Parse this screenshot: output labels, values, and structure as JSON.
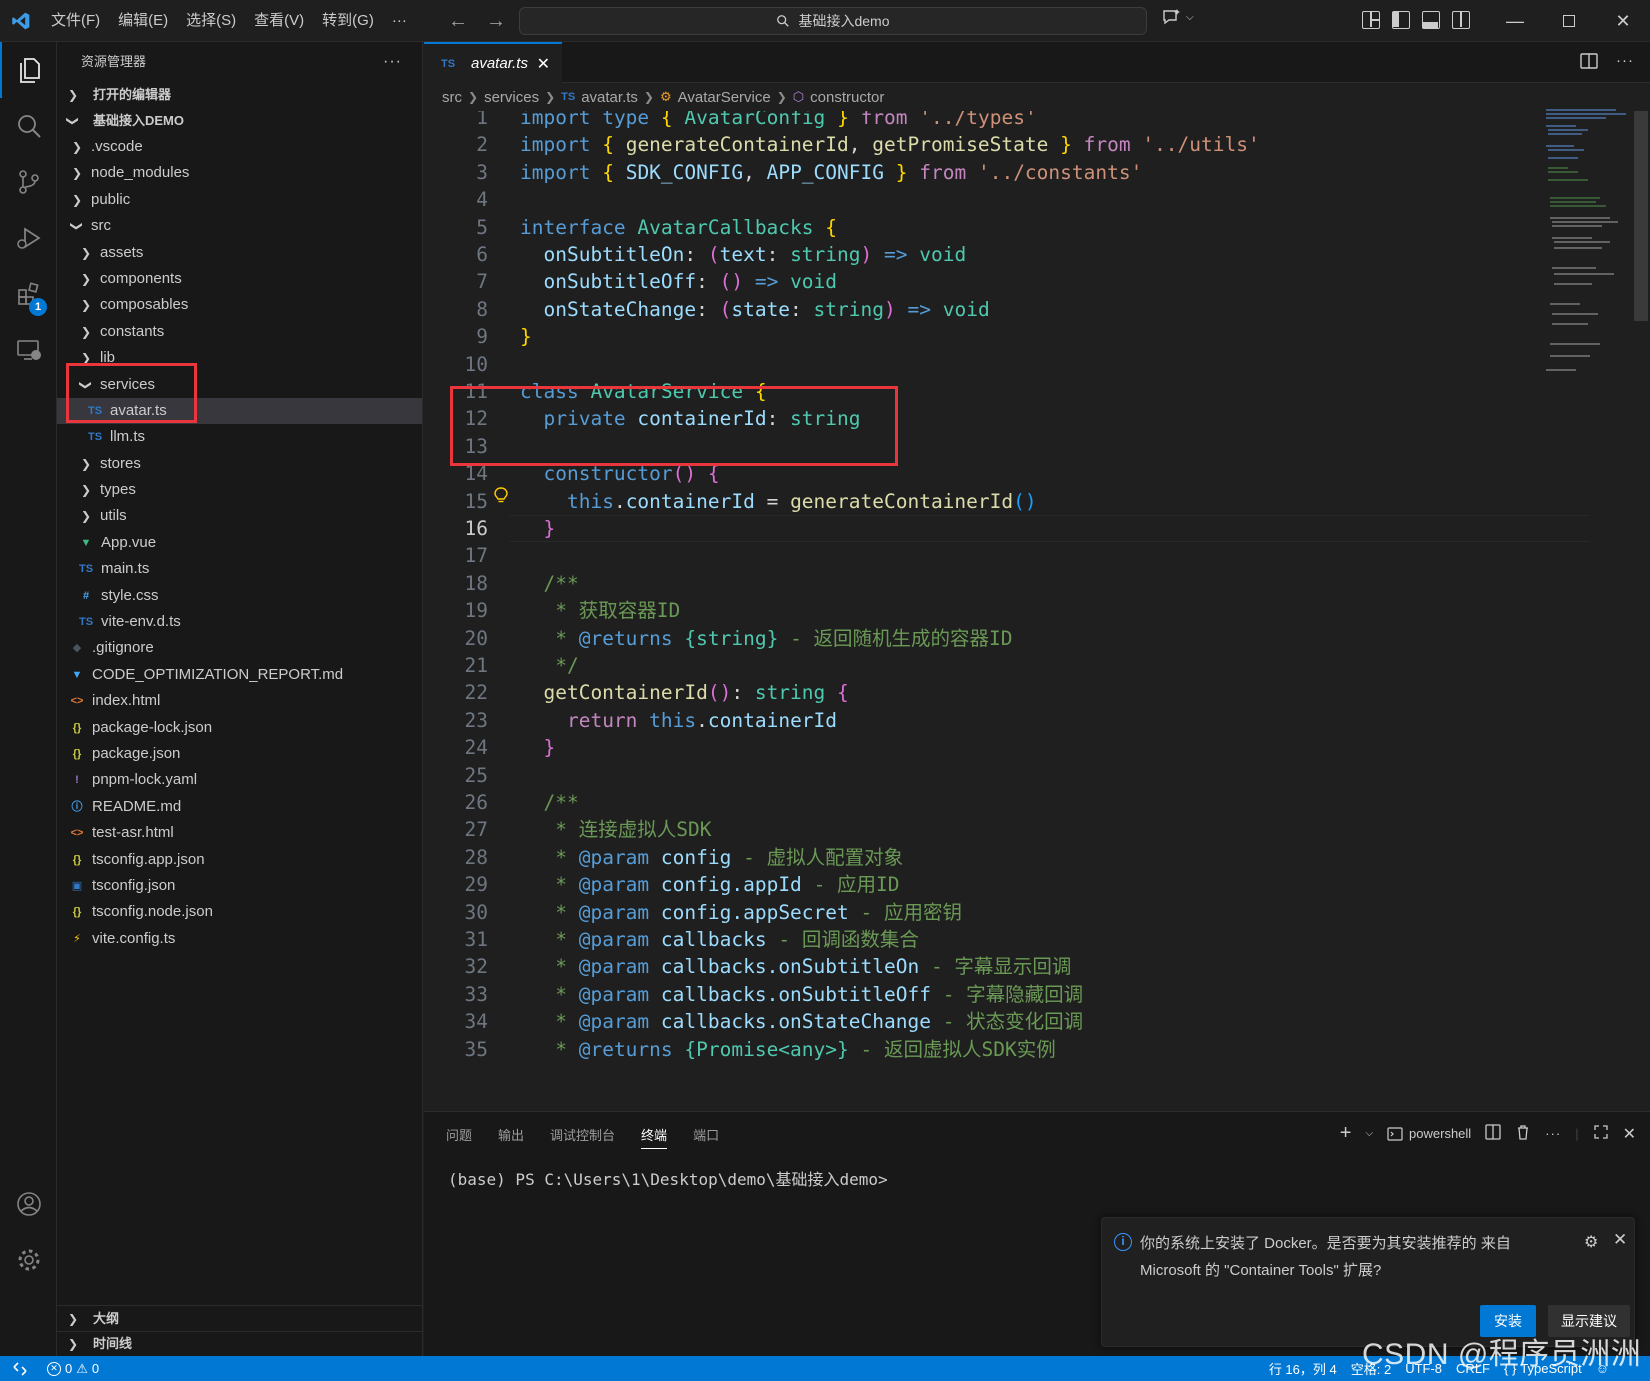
{
  "titlebar": {
    "menus": [
      "文件(F)",
      "编辑(E)",
      "选择(S)",
      "查看(V)",
      "转到(G)",
      "···"
    ],
    "search_text": "基础接入demo"
  },
  "activity": {
    "extensions_badge": "1"
  },
  "sidebar": {
    "title": "资源管理器",
    "more": "···",
    "open_editors": "打开的编辑器",
    "workspace": "基础接入DEMO",
    "tree": [
      {
        "label": ".vscode",
        "depth": 1,
        "type": "folder",
        "open": false
      },
      {
        "label": "node_modules",
        "depth": 1,
        "type": "folder",
        "open": false
      },
      {
        "label": "public",
        "depth": 1,
        "type": "folder",
        "open": false
      },
      {
        "label": "src",
        "depth": 1,
        "type": "folder",
        "open": true
      },
      {
        "label": "assets",
        "depth": 2,
        "type": "folder",
        "open": false
      },
      {
        "label": "components",
        "depth": 2,
        "type": "folder",
        "open": false
      },
      {
        "label": "composables",
        "depth": 2,
        "type": "folder",
        "open": false
      },
      {
        "label": "constants",
        "depth": 2,
        "type": "folder",
        "open": false
      },
      {
        "label": "lib",
        "depth": 2,
        "type": "folder",
        "open": false
      },
      {
        "label": "services",
        "depth": 2,
        "type": "folder",
        "open": true
      },
      {
        "label": "avatar.ts",
        "depth": 3,
        "type": "ts",
        "selected": true
      },
      {
        "label": "llm.ts",
        "depth": 3,
        "type": "ts"
      },
      {
        "label": "stores",
        "depth": 2,
        "type": "folder",
        "open": false
      },
      {
        "label": "types",
        "depth": 2,
        "type": "folder",
        "open": false
      },
      {
        "label": "utils",
        "depth": 2,
        "type": "folder",
        "open": false
      },
      {
        "label": "App.vue",
        "depth": 2,
        "type": "vue"
      },
      {
        "label": "main.ts",
        "depth": 2,
        "type": "ts"
      },
      {
        "label": "style.css",
        "depth": 2,
        "type": "css"
      },
      {
        "label": "vite-env.d.ts",
        "depth": 2,
        "type": "ts"
      },
      {
        "label": ".gitignore",
        "depth": 1,
        "type": "git"
      },
      {
        "label": "CODE_OPTIMIZATION_REPORT.md",
        "depth": 1,
        "type": "md"
      },
      {
        "label": "index.html",
        "depth": 1,
        "type": "html"
      },
      {
        "label": "package-lock.json",
        "depth": 1,
        "type": "json"
      },
      {
        "label": "package.json",
        "depth": 1,
        "type": "json"
      },
      {
        "label": "pnpm-lock.yaml",
        "depth": 1,
        "type": "yaml"
      },
      {
        "label": "README.md",
        "depth": 1,
        "type": "info"
      },
      {
        "label": "test-asr.html",
        "depth": 1,
        "type": "html"
      },
      {
        "label": "tsconfig.app.json",
        "depth": 1,
        "type": "json"
      },
      {
        "label": "tsconfig.json",
        "depth": 1,
        "type": "tsconfig"
      },
      {
        "label": "tsconfig.node.json",
        "depth": 1,
        "type": "json"
      },
      {
        "label": "vite.config.ts",
        "depth": 1,
        "type": "vite"
      }
    ],
    "outline": "大纲",
    "timeline": "时间线"
  },
  "editor": {
    "tab_label": "avatar.ts",
    "tab_lang": "TS",
    "breadcrumb": [
      "src",
      "services",
      "avatar.ts",
      "AvatarService",
      "constructor"
    ],
    "current_line": 16,
    "lines": [
      [
        [
          "k",
          "import"
        ],
        [
          null,
          " "
        ],
        [
          "k",
          "type"
        ],
        [
          null,
          " "
        ],
        [
          "y",
          "{"
        ],
        [
          null,
          " "
        ],
        [
          "t",
          "AvatarConfig"
        ],
        [
          null,
          " "
        ],
        [
          "y",
          "}"
        ],
        [
          null,
          " "
        ],
        [
          "c",
          "from"
        ],
        [
          null,
          " "
        ],
        [
          "s",
          "'../types'"
        ]
      ],
      [
        [
          "k",
          "import"
        ],
        [
          null,
          " "
        ],
        [
          "y",
          "{"
        ],
        [
          null,
          " "
        ],
        [
          "f",
          "generateContainerId"
        ],
        [
          null,
          ", "
        ],
        [
          "f",
          "getPromiseState"
        ],
        [
          null,
          " "
        ],
        [
          "y",
          "}"
        ],
        [
          null,
          " "
        ],
        [
          "c",
          "from"
        ],
        [
          null,
          " "
        ],
        [
          "s",
          "'../utils'"
        ]
      ],
      [
        [
          "k",
          "import"
        ],
        [
          null,
          " "
        ],
        [
          "y",
          "{"
        ],
        [
          null,
          " "
        ],
        [
          "v",
          "SDK_CONFIG"
        ],
        [
          null,
          ", "
        ],
        [
          "v",
          "APP_CONFIG"
        ],
        [
          null,
          " "
        ],
        [
          "y",
          "}"
        ],
        [
          null,
          " "
        ],
        [
          "c",
          "from"
        ],
        [
          null,
          " "
        ],
        [
          "s",
          "'../constants'"
        ]
      ],
      [],
      [
        [
          "k",
          "interface"
        ],
        [
          null,
          " "
        ],
        [
          "t",
          "AvatarCallbacks"
        ],
        [
          null,
          " "
        ],
        [
          "y",
          "{"
        ]
      ],
      [
        [
          null,
          "  "
        ],
        [
          "v",
          "onSubtitleOn"
        ],
        [
          null,
          ": "
        ],
        [
          "p",
          "("
        ],
        [
          "v",
          "text"
        ],
        [
          null,
          ": "
        ],
        [
          "t",
          "string"
        ],
        [
          "p",
          ")"
        ],
        [
          null,
          " "
        ],
        [
          "k",
          "=>"
        ],
        [
          null,
          " "
        ],
        [
          "t",
          "void"
        ]
      ],
      [
        [
          null,
          "  "
        ],
        [
          "v",
          "onSubtitleOff"
        ],
        [
          null,
          ": "
        ],
        [
          "p",
          "()"
        ],
        [
          null,
          " "
        ],
        [
          "k",
          "=>"
        ],
        [
          null,
          " "
        ],
        [
          "t",
          "void"
        ]
      ],
      [
        [
          null,
          "  "
        ],
        [
          "v",
          "onStateChange"
        ],
        [
          null,
          ": "
        ],
        [
          "p",
          "("
        ],
        [
          "v",
          "state"
        ],
        [
          null,
          ": "
        ],
        [
          "t",
          "string"
        ],
        [
          "p",
          ")"
        ],
        [
          null,
          " "
        ],
        [
          "k",
          "=>"
        ],
        [
          null,
          " "
        ],
        [
          "t",
          "void"
        ]
      ],
      [
        [
          "y",
          "}"
        ]
      ],
      [],
      [
        [
          "k",
          "class"
        ],
        [
          null,
          " "
        ],
        [
          "t",
          "AvatarService"
        ],
        [
          null,
          " "
        ],
        [
          "y",
          "{"
        ]
      ],
      [
        [
          null,
          "  "
        ],
        [
          "k",
          "private"
        ],
        [
          null,
          " "
        ],
        [
          "v",
          "containerId"
        ],
        [
          null,
          ": "
        ],
        [
          "t",
          "string"
        ]
      ],
      [],
      [
        [
          null,
          "  "
        ],
        [
          "k",
          "constructor"
        ],
        [
          "p",
          "()"
        ],
        [
          null,
          " "
        ],
        [
          "p",
          "{"
        ]
      ],
      [
        [
          null,
          "    "
        ],
        [
          "k",
          "this"
        ],
        [
          null,
          "."
        ],
        [
          "v",
          "containerId"
        ],
        [
          null,
          " = "
        ],
        [
          "f",
          "generateContainerId"
        ],
        [
          "bl",
          "()"
        ]
      ],
      [
        [
          null,
          "  "
        ],
        [
          "p",
          "}"
        ]
      ],
      [],
      [
        [
          null,
          "  "
        ],
        [
          "g",
          "/**"
        ]
      ],
      [
        [
          null,
          "   "
        ],
        [
          "g",
          "* 获取容器ID"
        ]
      ],
      [
        [
          null,
          "   "
        ],
        [
          "g",
          "* "
        ],
        [
          "k",
          "@returns"
        ],
        [
          null,
          " "
        ],
        [
          "t",
          "{string}"
        ],
        [
          null,
          " "
        ],
        [
          "g",
          "- 返回随机生成的容器ID"
        ]
      ],
      [
        [
          null,
          "   "
        ],
        [
          "g",
          "*/"
        ]
      ],
      [
        [
          null,
          "  "
        ],
        [
          "f",
          "getContainerId"
        ],
        [
          "p",
          "()"
        ],
        [
          null,
          ": "
        ],
        [
          "t",
          "string"
        ],
        [
          null,
          " "
        ],
        [
          "p",
          "{"
        ]
      ],
      [
        [
          null,
          "    "
        ],
        [
          "c",
          "return"
        ],
        [
          null,
          " "
        ],
        [
          "k",
          "this"
        ],
        [
          null,
          "."
        ],
        [
          "v",
          "containerId"
        ]
      ],
      [
        [
          null,
          "  "
        ],
        [
          "p",
          "}"
        ]
      ],
      [],
      [
        [
          null,
          "  "
        ],
        [
          "g",
          "/**"
        ]
      ],
      [
        [
          null,
          "   "
        ],
        [
          "g",
          "* 连接虚拟人SDK"
        ]
      ],
      [
        [
          null,
          "   "
        ],
        [
          "g",
          "* "
        ],
        [
          "k",
          "@param"
        ],
        [
          null,
          " "
        ],
        [
          "v",
          "config"
        ],
        [
          null,
          " "
        ],
        [
          "g",
          "- 虚拟人配置对象"
        ]
      ],
      [
        [
          null,
          "   "
        ],
        [
          "g",
          "* "
        ],
        [
          "k",
          "@param"
        ],
        [
          null,
          " "
        ],
        [
          "v",
          "config.appId"
        ],
        [
          null,
          " "
        ],
        [
          "g",
          "- 应用ID"
        ]
      ],
      [
        [
          null,
          "   "
        ],
        [
          "g",
          "* "
        ],
        [
          "k",
          "@param"
        ],
        [
          null,
          " "
        ],
        [
          "v",
          "config.appSecret"
        ],
        [
          null,
          " "
        ],
        [
          "g",
          "- 应用密钥"
        ]
      ],
      [
        [
          null,
          "   "
        ],
        [
          "g",
          "* "
        ],
        [
          "k",
          "@param"
        ],
        [
          null,
          " "
        ],
        [
          "v",
          "callbacks"
        ],
        [
          null,
          " "
        ],
        [
          "g",
          "- 回调函数集合"
        ]
      ],
      [
        [
          null,
          "   "
        ],
        [
          "g",
          "* "
        ],
        [
          "k",
          "@param"
        ],
        [
          null,
          " "
        ],
        [
          "v",
          "callbacks.onSubtitleOn"
        ],
        [
          null,
          " "
        ],
        [
          "g",
          "- 字幕显示回调"
        ]
      ],
      [
        [
          null,
          "   "
        ],
        [
          "g",
          "* "
        ],
        [
          "k",
          "@param"
        ],
        [
          null,
          " "
        ],
        [
          "v",
          "callbacks.onSubtitleOff"
        ],
        [
          null,
          " "
        ],
        [
          "g",
          "- 字幕隐藏回调"
        ]
      ],
      [
        [
          null,
          "   "
        ],
        [
          "g",
          "* "
        ],
        [
          "k",
          "@param"
        ],
        [
          null,
          " "
        ],
        [
          "v",
          "callbacks.onStateChange"
        ],
        [
          null,
          " "
        ],
        [
          "g",
          "- 状态变化回调"
        ]
      ],
      [
        [
          null,
          "   "
        ],
        [
          "g",
          "* "
        ],
        [
          "k",
          "@returns"
        ],
        [
          null,
          " "
        ],
        [
          "t",
          "{Promise<any>}"
        ],
        [
          null,
          " "
        ],
        [
          "g",
          "- 返回虚拟人SDK实例"
        ]
      ]
    ]
  },
  "panel": {
    "tabs": [
      "问题",
      "输出",
      "调试控制台",
      "终端",
      "端口"
    ],
    "active_tab": "终端",
    "shell": "powershell",
    "prompt": "(base) PS C:\\Users\\1\\Desktop\\demo\\基础接入demo>"
  },
  "notification": {
    "message": "你的系统上安装了 Docker。是否要为其安装推荐的 来自 Microsoft 的 \"Container Tools\" 扩展?",
    "primary": "安装",
    "secondary": "显示建议"
  },
  "statusbar": {
    "errors": "0",
    "warnings": "0",
    "position": "行 16，列 4",
    "spaces": "空格: 2",
    "encoding": "UTF-8",
    "eol": "CRLF",
    "language": "TypeScript"
  },
  "watermark": "CSDN @程序员洲洲",
  "colors": {
    "accent": "#0078d4",
    "highlight_box": "#e8363c",
    "editor_bg": "#1f1f1f",
    "sidebar_bg": "#181818"
  }
}
